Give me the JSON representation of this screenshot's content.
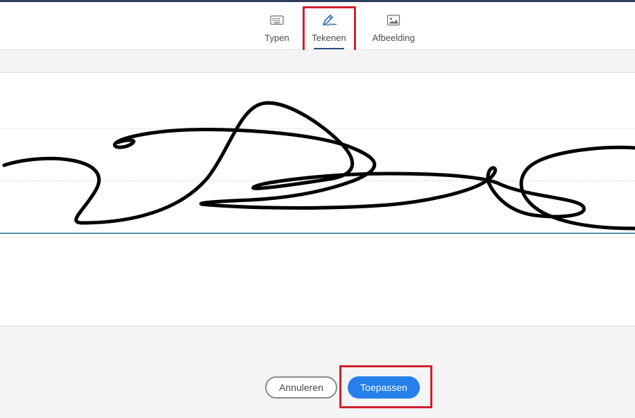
{
  "tabs": {
    "type_label": "Typen",
    "draw_label": "Tekenen",
    "image_label": "Afbeelding",
    "active": "Tekenen"
  },
  "icons": {
    "type": "keyboard-icon",
    "draw": "pen-signature-icon",
    "image": "image-icon"
  },
  "footer": {
    "cancel_label": "Annuleren",
    "apply_label": "Toepassen"
  },
  "colors": {
    "accent": "#2680eb",
    "highlight": "#d0202a",
    "baseline": "#4a90a6"
  }
}
